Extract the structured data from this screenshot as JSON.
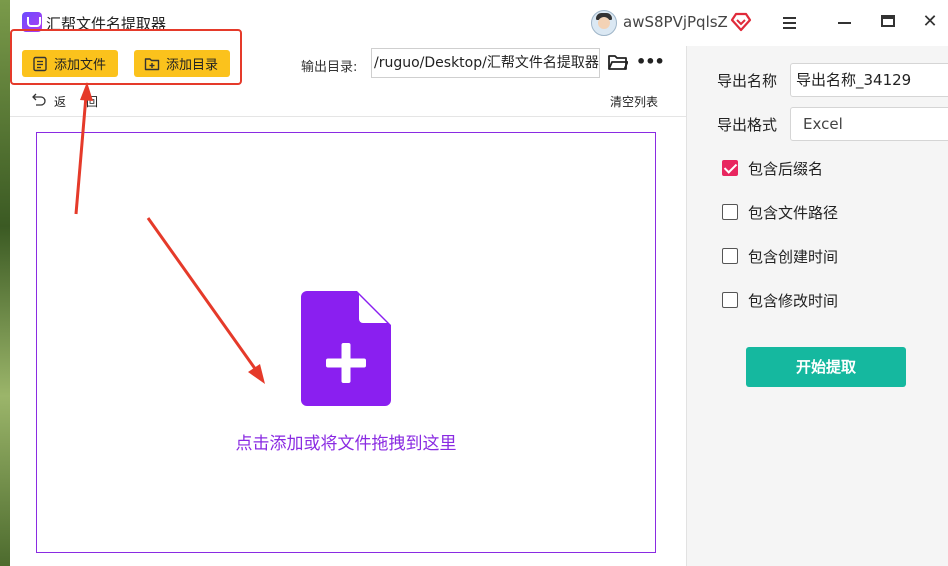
{
  "window": {
    "title": "汇帮文件名提取器",
    "user_name": "awS8PVjPqlsZ",
    "icons": [
      "app-logo-icon",
      "user-avatar",
      "vip-heart-icon",
      "menu-icon",
      "minimize-icon",
      "maximize-icon",
      "close-icon"
    ]
  },
  "toolbar": {
    "add_file_label": "添加文件",
    "add_dir_label": "添加目录",
    "output_dir_label": "输出目录:",
    "output_dir_value": "/ruguo/Desktop/汇帮文件名提取器",
    "more_label": "•••",
    "back_label": "返回",
    "clear_list_label": "清空列表"
  },
  "drop_zone": {
    "hint": "点击添加或将文件拖拽到这里",
    "icon": "add-file-icon"
  },
  "right_panel": {
    "export_name_label": "导出名称",
    "export_name_value": "导出名称_34129",
    "export_format_label": "导出格式",
    "export_format_value": "Excel",
    "options": [
      {
        "label": "包含后缀名",
        "checked": true
      },
      {
        "label": "包含文件路径",
        "checked": false
      },
      {
        "label": "包含创建时间",
        "checked": false
      },
      {
        "label": "包含修改时间",
        "checked": false
      }
    ],
    "start_label": "开始提取"
  },
  "colors": {
    "accent_yellow": "#fbc21c",
    "annotation_red": "#e53a2a",
    "purple": "#8a2be2",
    "teal": "#15b89f",
    "check_pink": "#e8265f"
  }
}
